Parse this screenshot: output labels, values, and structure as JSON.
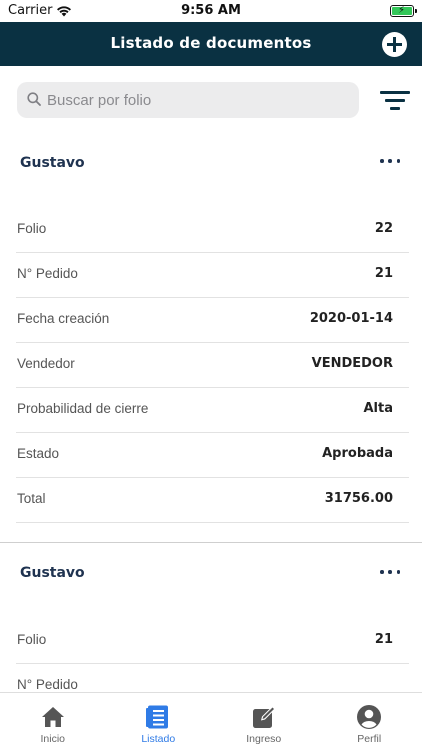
{
  "status_bar": {
    "carrier": "Carrier",
    "time": "9:56 AM"
  },
  "header": {
    "title": "Listado de documentos"
  },
  "search": {
    "placeholder": "Buscar por folio"
  },
  "documents": [
    {
      "client": "Gustavo",
      "fields": [
        {
          "label": "Folio",
          "value": "22"
        },
        {
          "label": "N° Pedido",
          "value": "21"
        },
        {
          "label": "Fecha creación",
          "value": "2020-01-14"
        },
        {
          "label": "Vendedor",
          "value": "VENDEDOR"
        },
        {
          "label": "Probabilidad de cierre",
          "value": "Alta"
        },
        {
          "label": "Estado",
          "value": "Aprobada"
        },
        {
          "label": "Total",
          "value": "31756.00"
        }
      ]
    },
    {
      "client": "Gustavo",
      "fields": [
        {
          "label": "Folio",
          "value": "21"
        },
        {
          "label": "N° Pedido",
          "value": ""
        }
      ]
    }
  ],
  "tabs": [
    {
      "label": "Inicio",
      "icon": "home-icon"
    },
    {
      "label": "Listado",
      "icon": "list-icon",
      "active": true
    },
    {
      "label": "Ingreso",
      "icon": "edit-icon"
    },
    {
      "label": "Perfil",
      "icon": "profile-icon"
    }
  ],
  "colors": {
    "header": "#0a3142",
    "accent": "#2f7be6",
    "battery": "#33c759"
  }
}
